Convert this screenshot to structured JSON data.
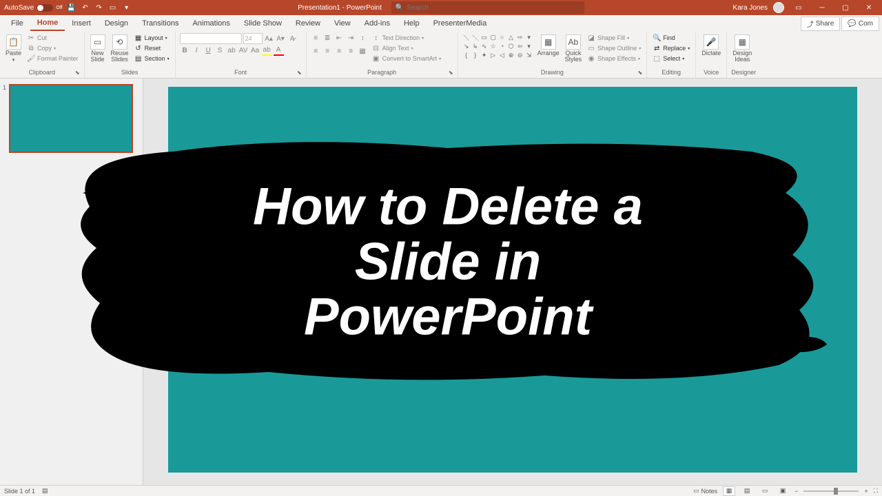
{
  "titlebar": {
    "autosave_label": "AutoSave",
    "autosave_state": "Off",
    "doc_title": "Presentation1 - PowerPoint",
    "search_placeholder": "Search",
    "user_name": "Kara Jones"
  },
  "menu": {
    "tabs": [
      "File",
      "Home",
      "Insert",
      "Design",
      "Transitions",
      "Animations",
      "Slide Show",
      "Review",
      "View",
      "Add-ins",
      "Help",
      "PresenterMedia"
    ],
    "active": "Home",
    "share": "Share",
    "comments": "Com"
  },
  "ribbon": {
    "clipboard": {
      "label": "Clipboard",
      "paste": "Paste",
      "cut": "Cut",
      "copy": "Copy",
      "format_painter": "Format Painter"
    },
    "slides": {
      "label": "Slides",
      "new_slide": "New\nSlide",
      "reuse_slides": "Reuse\nSlides",
      "layout": "Layout",
      "reset": "Reset",
      "section": "Section"
    },
    "font": {
      "label": "Font",
      "size": "24"
    },
    "paragraph": {
      "label": "Paragraph",
      "text_direction": "Text Direction",
      "align_text": "Align Text",
      "convert": "Convert to SmartArt"
    },
    "drawing": {
      "label": "Drawing",
      "arrange": "Arrange",
      "quick_styles": "Quick\nStyles",
      "shape_fill": "Shape Fill",
      "shape_outline": "Shape Outline",
      "shape_effects": "Shape Effects"
    },
    "editing": {
      "label": "Editing",
      "find": "Find",
      "replace": "Replace",
      "select": "Select"
    },
    "voice": {
      "label": "Voice",
      "dictate": "Dictate"
    },
    "designer": {
      "label": "Designer",
      "design_ideas": "Design\nIdeas"
    }
  },
  "slides_panel": {
    "thumbs": [
      {
        "num": "1"
      }
    ]
  },
  "statusbar": {
    "slide_info": "Slide 1 of 1",
    "notes": "Notes"
  },
  "overlay": {
    "line1": "How to Delete a",
    "line2": "Slide in",
    "line3": "PowerPoint"
  }
}
